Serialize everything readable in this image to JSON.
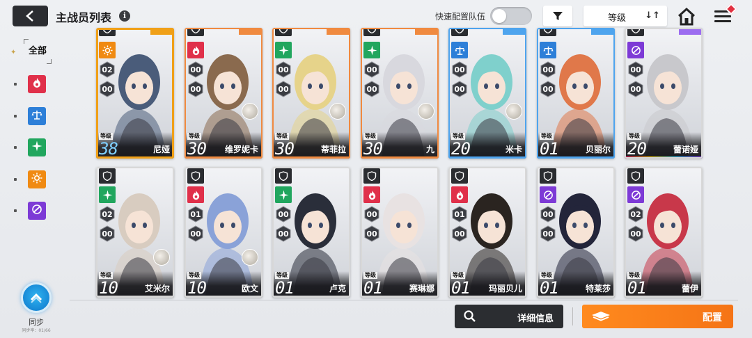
{
  "header": {
    "title": "主战员列表",
    "info_icon": "i",
    "quick_config_label": "快速配置队伍",
    "quick_config_enabled": false,
    "sort_label": "等级",
    "sort_icon": "↓↑"
  },
  "sidebar": {
    "all_label": "全部",
    "items": [
      {
        "icon": "fire-element-icon",
        "color": "#e0304a"
      },
      {
        "icon": "balance-element-icon",
        "color": "#2d7fd8"
      },
      {
        "icon": "wind-element-icon",
        "color": "#21a65e"
      },
      {
        "icon": "sun-element-icon",
        "color": "#f08a12"
      },
      {
        "icon": "void-element-icon",
        "color": "#7d3ad6"
      }
    ],
    "sync_label": "同步",
    "sync_sub": "同步率：01/66"
  },
  "level_word": "等级",
  "cards": [
    {
      "name": "尼娅",
      "level": "38",
      "rank_a": "02",
      "rank_b": "00",
      "element": "sun",
      "frame": "#f0a018",
      "rarity_color": "#f0a018",
      "hair": "#4a5c7a",
      "selected": true
    },
    {
      "name": "维罗妮卡",
      "level": "30",
      "rank_a": "00",
      "rank_b": "00",
      "element": "fire",
      "frame": "#f08a40",
      "rarity_color": "#f08a40",
      "hair": "#8a6a4e",
      "selected": false
    },
    {
      "name": "蒂菲拉",
      "level": "30",
      "rank_a": "00",
      "rank_b": "00",
      "element": "wind",
      "frame": "#f08a40",
      "rarity_color": "#f08a40",
      "hair": "#e6d38a",
      "selected": false
    },
    {
      "name": "九",
      "level": "30",
      "rank_a": "00",
      "rank_b": "00",
      "element": "wind",
      "frame": "#f08a40",
      "rarity_color": "#f08a40",
      "hair": "#d8d8de",
      "selected": false
    },
    {
      "name": "米卡",
      "level": "20",
      "rank_a": "00",
      "rank_b": "00",
      "element": "balance",
      "frame": "#4ea4ee",
      "rarity_color": "#4ea4ee",
      "hair": "#7fd0cc",
      "selected": false
    },
    {
      "name": "贝丽尔",
      "level": "01",
      "rank_a": "00",
      "rank_b": "00",
      "element": "balance",
      "frame": "#4ea4ee",
      "rarity_color": "#4ea4ee",
      "hair": "#e0784a",
      "selected": false
    },
    {
      "name": "蕾诺娅",
      "level": "20",
      "rank_a": "00",
      "rank_b": "00",
      "element": "void",
      "frame": "#d8d8d8",
      "rarity_color": "#9c6cf0",
      "hair": "#c8c8cc",
      "selected": false
    },
    {
      "name": "艾米尔",
      "level": "10",
      "rank_a": "02",
      "rank_b": "00",
      "element": "wind",
      "frame": "#d8d8d8",
      "rarity_color": "#c8c8c8",
      "hair": "#d8ccc0",
      "selected": false
    },
    {
      "name": "欧文",
      "level": "10",
      "rank_a": "01",
      "rank_b": "00",
      "element": "fire",
      "frame": "#d8d8d8",
      "rarity_color": "#c8c8c8",
      "hair": "#8aa2d8",
      "selected": false
    },
    {
      "name": "卢克",
      "level": "01",
      "rank_a": "00",
      "rank_b": "00",
      "element": "wind",
      "frame": "#d8d8d8",
      "rarity_color": "#c8c8c8",
      "hair": "#2a2e3a",
      "selected": false
    },
    {
      "name": "赛琳娜",
      "level": "01",
      "rank_a": "00",
      "rank_b": "00",
      "element": "fire",
      "frame": "#d8d8d8",
      "rarity_color": "#c8c8c8",
      "hair": "#e8e2e2",
      "selected": false
    },
    {
      "name": "玛丽贝儿",
      "level": "01",
      "rank_a": "01",
      "rank_b": "00",
      "element": "fire",
      "frame": "#d8d8d8",
      "rarity_color": "#c8c8c8",
      "hair": "#2a2420",
      "selected": false
    },
    {
      "name": "特莱莎",
      "level": "01",
      "rank_a": "00",
      "rank_b": "00",
      "element": "void",
      "frame": "#d8d8d8",
      "rarity_color": "#c8c8c8",
      "hair": "#23253a",
      "selected": false
    },
    {
      "name": "蕾伊",
      "level": "01",
      "rank_a": "02",
      "rank_b": "00",
      "element": "void",
      "frame": "#d8d8d8",
      "rarity_color": "#c8c8c8",
      "hair": "#c8384a",
      "selected": false
    }
  ],
  "footer": {
    "detail_label": "详细信息",
    "config_label": "配置"
  }
}
